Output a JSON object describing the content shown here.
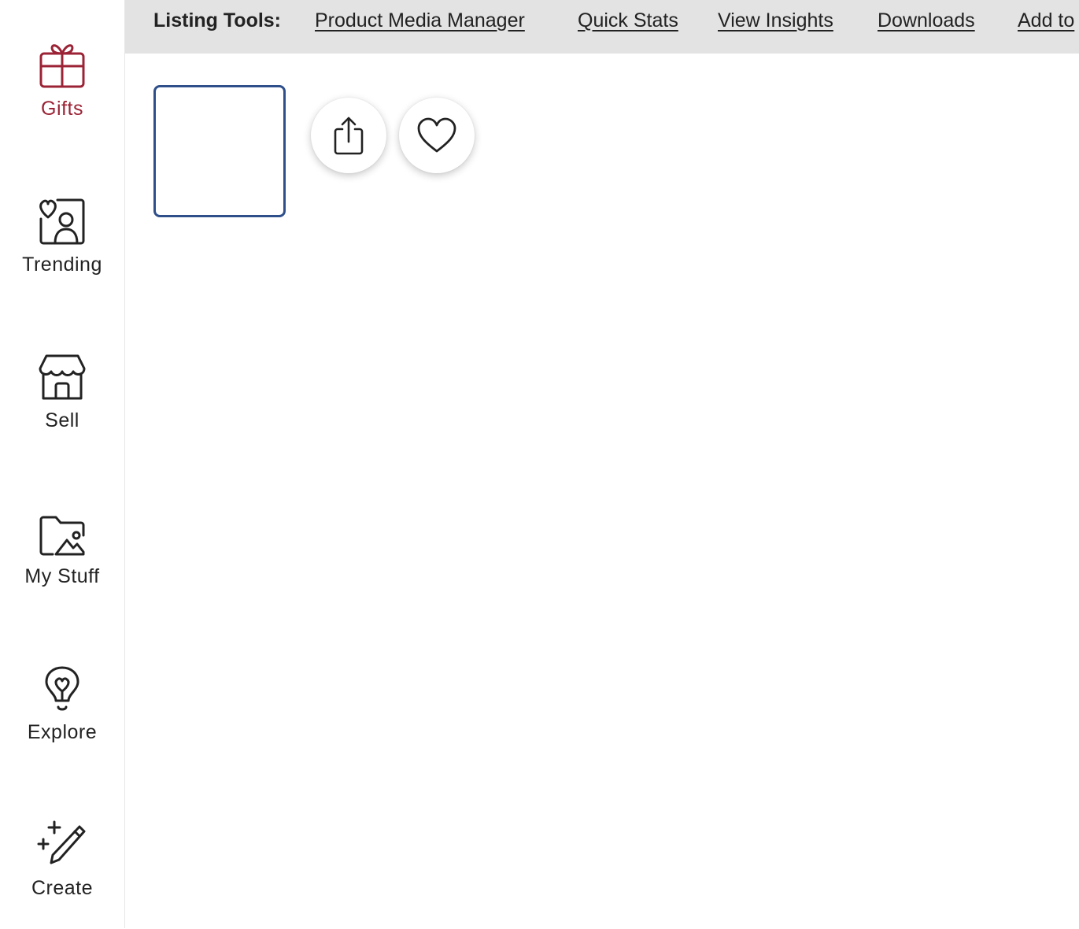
{
  "sidebar": {
    "items": [
      {
        "label": "Gifts",
        "icon": "gift-icon",
        "active": true
      },
      {
        "label": "Trending",
        "icon": "trending-heart-person-icon",
        "active": false
      },
      {
        "label": "Sell",
        "icon": "storefront-icon",
        "active": false
      },
      {
        "label": "My Stuff",
        "icon": "folder-image-icon",
        "active": false
      },
      {
        "label": "Explore",
        "icon": "lightbulb-heart-icon",
        "active": false
      },
      {
        "label": "Create",
        "icon": "pencil-sparkle-icon",
        "active": false
      }
    ]
  },
  "toolbar": {
    "title": "Listing Tools:",
    "links": [
      "Product Media Manager",
      "Quick Stats",
      "View Insights",
      "Downloads",
      "Add to"
    ]
  },
  "actions": {
    "share_icon": "share-icon",
    "favorite_icon": "heart-icon"
  },
  "colors": {
    "active_accent": "#9b2335",
    "toolbar_bg": "#e3e3e3",
    "thumbnail_border": "#2f4f8a",
    "text": "#222222"
  }
}
